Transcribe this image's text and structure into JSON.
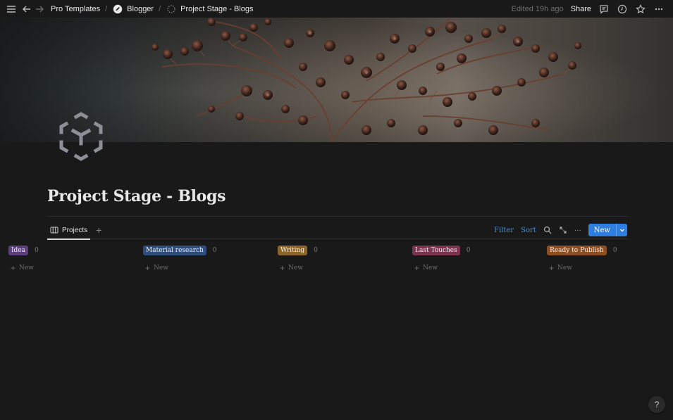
{
  "topbar": {
    "breadcrumbs": [
      {
        "label": "Pro Templates"
      },
      {
        "label": "Blogger"
      },
      {
        "label": "Project Stage - Blogs"
      }
    ],
    "separator": "/",
    "edited": "Edited 19h ago",
    "share": "Share"
  },
  "page": {
    "title": "Project Stage - Blogs"
  },
  "views": {
    "tabs": [
      {
        "label": "Projects"
      }
    ],
    "add": "+",
    "filter": "Filter",
    "sort": "Sort",
    "more": "···",
    "new_label": "New",
    "accent": "#2f7fe0"
  },
  "board": {
    "columns": [
      {
        "label": "Idea",
        "count": "0",
        "color": "#5a3f7a",
        "new_label": "New"
      },
      {
        "label": "Material research",
        "count": "0",
        "color": "#2f4d7a",
        "new_label": "New"
      },
      {
        "label": "Writing",
        "count": "0",
        "color": "#8a6429",
        "new_label": "New"
      },
      {
        "label": "Last Touches",
        "count": "0",
        "color": "#7a344f",
        "new_label": "New"
      },
      {
        "label": "Ready to Publish",
        "count": "0",
        "color": "#8a4e22",
        "new_label": "New"
      }
    ]
  },
  "help": "?"
}
